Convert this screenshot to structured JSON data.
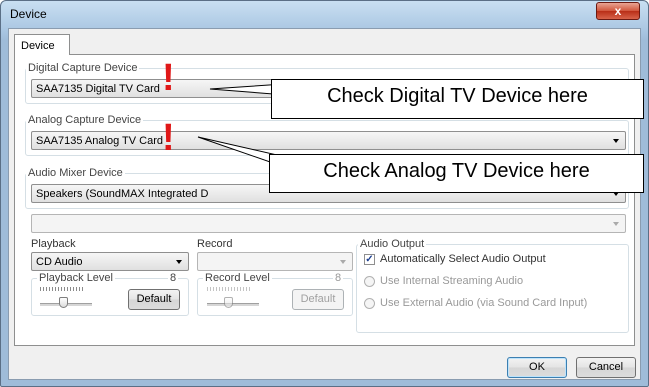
{
  "window": {
    "title": "Device",
    "close_glyph": "x"
  },
  "tab": {
    "label": "Device"
  },
  "digital": {
    "label": "Digital Capture Device",
    "value": "SAA7135 Digital TV Card"
  },
  "analog": {
    "label": "Analog Capture Device",
    "value": "SAA7135 Analog TV Card"
  },
  "audio_mixer": {
    "label": "Audio Mixer Device",
    "value": "Speakers (SoundMAX Integrated D",
    "second_value": ""
  },
  "playback": {
    "label": "Playback",
    "value": "CD Audio",
    "level_label": "Playback Level",
    "level_value": "8",
    "default_label": "Default"
  },
  "record": {
    "label": "Record",
    "value": "",
    "level_label": "Record Level",
    "level_value": "8",
    "default_label": "Default"
  },
  "audio_output": {
    "label": "Audio Output",
    "auto_label": "Automatically Select Audio Output",
    "auto_checked": true,
    "internal_label": "Use Internal Streaming Audio",
    "external_label": "Use External Audio (via Sound Card Input)"
  },
  "footer": {
    "ok_label": "OK",
    "cancel_label": "Cancel"
  },
  "callouts": {
    "digital_text": "Check Digital TV Device here",
    "analog_text": "Check Analog TV Device here",
    "mark": "!"
  },
  "colors": {
    "exclaim": "#e01818",
    "close_button": "#c9432b"
  }
}
